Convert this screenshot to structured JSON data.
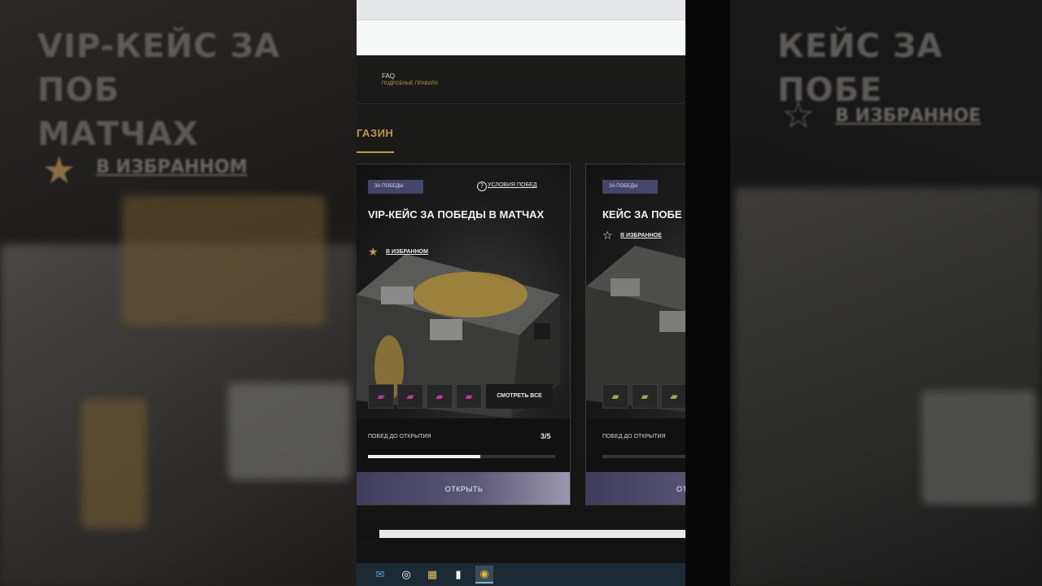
{
  "left_bg": {
    "title": "VIP-КЕЙС ЗА ПОБЕДЫ В МАТЧАХ",
    "title_line1": "VIP-КЕЙС ЗА ПОБ",
    "title_line2": "МАТЧАХ",
    "fav_label": "В ИЗБРАННОМ"
  },
  "right_bg": {
    "title_line1": "КЕЙС ЗА ПОБЕ",
    "fav_label": "В ИЗБРАННОЕ"
  },
  "nav": {
    "faq_title": "FAQ",
    "faq_subtitle": "ПОДРОБНЫЕ ПРАВИЛА",
    "shop_tab": "ГАЗИН"
  },
  "cards": [
    {
      "tag": "ЗА ПОБЕДЫ",
      "conditions": "УСЛОВИЯ ПОБЕД",
      "title": "VIP-КЕЙС ЗА ПОБЕДЫ В МАТЧАХ",
      "fav_label": "В ИЗБРАННОМ",
      "fav_icon": "star-filled-icon",
      "see_all": "СМОТРЕТЬ ВСЕ",
      "progress_label": "ПОБЕД ДО ОТКРЫТИЯ",
      "progress_count": "3/5",
      "progress_fraction": 0.6,
      "open_label": "ОТКРЫТЬ"
    },
    {
      "tag": "ЗА ПОБЕДЫ",
      "title": "КЕЙС ЗА ПОБЕ",
      "fav_label": "В ИЗБРАННОЕ",
      "fav_icon": "star-outline-icon",
      "progress_label": "ПОБЕД ДО ОТКРЫТИЯ",
      "open_label": "ОТ"
    }
  ],
  "colors": {
    "accent_gold": "#c0974f",
    "tag_purple": "#45456a",
    "button_gradient_start": "#3f3b5c",
    "button_gradient_end": "#9c98ae"
  },
  "taskbar": {
    "icons": [
      "mail-icon",
      "obs-icon",
      "app-grid-icon",
      "chart-app-icon",
      "chrome-icon"
    ]
  }
}
